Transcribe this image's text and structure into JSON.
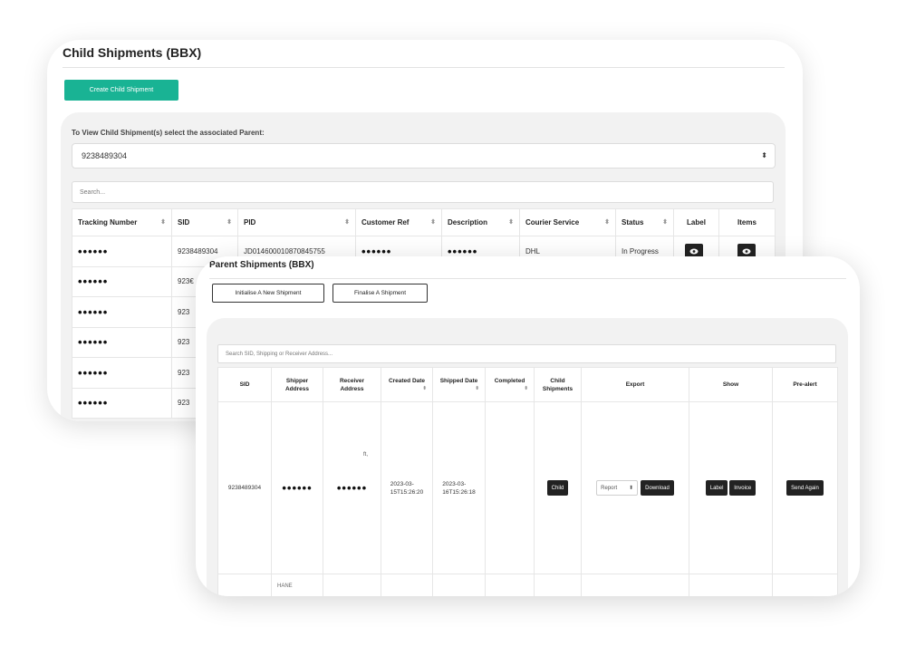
{
  "child": {
    "title": "Child Shipments (BBX)",
    "create_button": "Create Child Shipment",
    "instruction": "To View Child Shipment(s) select the associated Parent:",
    "selected_parent": "9238489304",
    "search_placeholder": "Search...",
    "columns": [
      "Tracking Number",
      "SID",
      "PID",
      "Customer Ref",
      "Description",
      "Courier Service",
      "Status",
      "Label",
      "Items"
    ],
    "rows": [
      {
        "tracking": "••••••",
        "sid": "9238489304",
        "pid": "JD014600010870845755",
        "customer_ref": "••••••",
        "description": "••••••",
        "courier": "DHL",
        "status": "In Progress"
      },
      {
        "tracking": "••••••",
        "sid": "923€"
      },
      {
        "tracking": "••••••",
        "sid": "923"
      },
      {
        "tracking": "••••••",
        "sid": "923"
      },
      {
        "tracking": "••••••",
        "sid": "923"
      },
      {
        "tracking": "••••••",
        "sid": "923"
      }
    ]
  },
  "parent": {
    "title": "Parent Shipments (BBX)",
    "init_button": "Initialise A New Shipment",
    "finalise_button": "Finalise A Shipment",
    "search_placeholder": "Search SID, Shipping or Receiver Address...",
    "columns": {
      "sid": "SID",
      "shipper": [
        "Shipper",
        "Address"
      ],
      "receiver": [
        "Receiver",
        "Address"
      ],
      "created": "Created Date",
      "shipped": "Shipped Date",
      "completed": "Completed",
      "child": [
        "Child",
        "Shipments"
      ],
      "export": "Export",
      "show": "Show",
      "prealert": "Pre-alert"
    },
    "row": {
      "sid": "9238489304",
      "shipper": "••••••",
      "receiver": "••••••",
      "receiver_note": "ft,",
      "created": [
        "2023-03-",
        "15T15:26:20"
      ],
      "shipped": [
        "2023-03-",
        "16T15:26:18"
      ],
      "child_button": "Child",
      "report_select": "Report",
      "download_button": "Download",
      "label_button": "Label",
      "invoice_button": "Invoice",
      "send_button": "Send Again"
    },
    "row2_shipper_partial": "HANE"
  }
}
